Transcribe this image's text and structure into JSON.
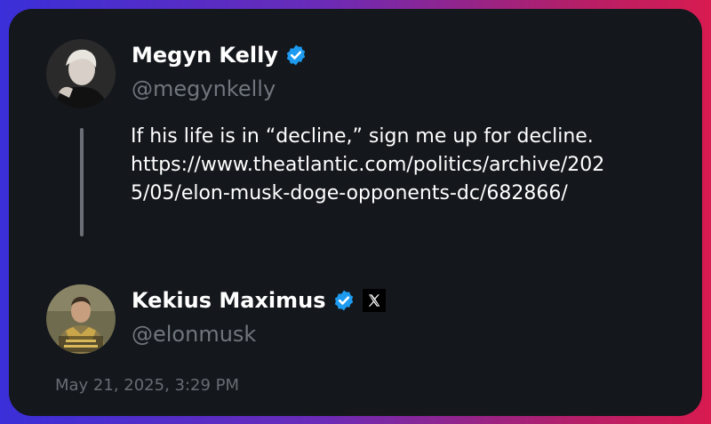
{
  "tweet": {
    "author": {
      "name": "Megyn Kelly",
      "handle": "@megynkelly",
      "verified": true
    },
    "text_lines": [
      "If his life is in “decline,” sign me up for decline.",
      "https://www.theatlantic.com/politics/archive/202",
      "5/05/elon-musk-doge-opponents-dc/682866/"
    ]
  },
  "reply": {
    "author": {
      "name": "Kekius Maximus",
      "handle": "@elonmusk",
      "verified": true,
      "affiliate_icon": "x-logo-icon"
    }
  },
  "timestamp": "May 21, 2025, 3:29 PM",
  "colors": {
    "verified_badge": "#1d9bf0",
    "card_background": "#14171c",
    "handle_text": "#70767d",
    "thread_line": "#6b6f75"
  }
}
